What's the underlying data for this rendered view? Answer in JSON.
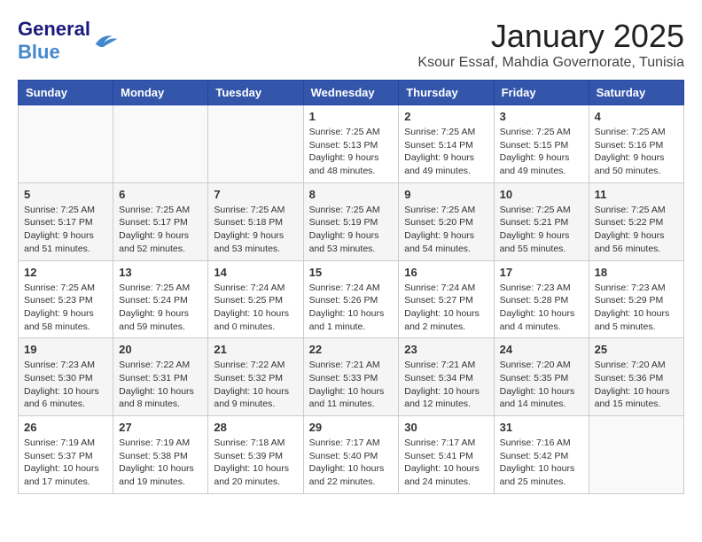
{
  "logo": {
    "general": "General",
    "blue": "Blue"
  },
  "title": "January 2025",
  "subtitle": "Ksour Essaf, Mahdia Governorate, Tunisia",
  "days_of_week": [
    "Sunday",
    "Monday",
    "Tuesday",
    "Wednesday",
    "Thursday",
    "Friday",
    "Saturday"
  ],
  "weeks": [
    [
      {
        "day": "",
        "info": ""
      },
      {
        "day": "",
        "info": ""
      },
      {
        "day": "",
        "info": ""
      },
      {
        "day": "1",
        "info": "Sunrise: 7:25 AM\nSunset: 5:13 PM\nDaylight: 9 hours\nand 48 minutes."
      },
      {
        "day": "2",
        "info": "Sunrise: 7:25 AM\nSunset: 5:14 PM\nDaylight: 9 hours\nand 49 minutes."
      },
      {
        "day": "3",
        "info": "Sunrise: 7:25 AM\nSunset: 5:15 PM\nDaylight: 9 hours\nand 49 minutes."
      },
      {
        "day": "4",
        "info": "Sunrise: 7:25 AM\nSunset: 5:16 PM\nDaylight: 9 hours\nand 50 minutes."
      }
    ],
    [
      {
        "day": "5",
        "info": "Sunrise: 7:25 AM\nSunset: 5:17 PM\nDaylight: 9 hours\nand 51 minutes."
      },
      {
        "day": "6",
        "info": "Sunrise: 7:25 AM\nSunset: 5:17 PM\nDaylight: 9 hours\nand 52 minutes."
      },
      {
        "day": "7",
        "info": "Sunrise: 7:25 AM\nSunset: 5:18 PM\nDaylight: 9 hours\nand 53 minutes."
      },
      {
        "day": "8",
        "info": "Sunrise: 7:25 AM\nSunset: 5:19 PM\nDaylight: 9 hours\nand 53 minutes."
      },
      {
        "day": "9",
        "info": "Sunrise: 7:25 AM\nSunset: 5:20 PM\nDaylight: 9 hours\nand 54 minutes."
      },
      {
        "day": "10",
        "info": "Sunrise: 7:25 AM\nSunset: 5:21 PM\nDaylight: 9 hours\nand 55 minutes."
      },
      {
        "day": "11",
        "info": "Sunrise: 7:25 AM\nSunset: 5:22 PM\nDaylight: 9 hours\nand 56 minutes."
      }
    ],
    [
      {
        "day": "12",
        "info": "Sunrise: 7:25 AM\nSunset: 5:23 PM\nDaylight: 9 hours\nand 58 minutes."
      },
      {
        "day": "13",
        "info": "Sunrise: 7:25 AM\nSunset: 5:24 PM\nDaylight: 9 hours\nand 59 minutes."
      },
      {
        "day": "14",
        "info": "Sunrise: 7:24 AM\nSunset: 5:25 PM\nDaylight: 10 hours\nand 0 minutes."
      },
      {
        "day": "15",
        "info": "Sunrise: 7:24 AM\nSunset: 5:26 PM\nDaylight: 10 hours\nand 1 minute."
      },
      {
        "day": "16",
        "info": "Sunrise: 7:24 AM\nSunset: 5:27 PM\nDaylight: 10 hours\nand 2 minutes."
      },
      {
        "day": "17",
        "info": "Sunrise: 7:23 AM\nSunset: 5:28 PM\nDaylight: 10 hours\nand 4 minutes."
      },
      {
        "day": "18",
        "info": "Sunrise: 7:23 AM\nSunset: 5:29 PM\nDaylight: 10 hours\nand 5 minutes."
      }
    ],
    [
      {
        "day": "19",
        "info": "Sunrise: 7:23 AM\nSunset: 5:30 PM\nDaylight: 10 hours\nand 6 minutes."
      },
      {
        "day": "20",
        "info": "Sunrise: 7:22 AM\nSunset: 5:31 PM\nDaylight: 10 hours\nand 8 minutes."
      },
      {
        "day": "21",
        "info": "Sunrise: 7:22 AM\nSunset: 5:32 PM\nDaylight: 10 hours\nand 9 minutes."
      },
      {
        "day": "22",
        "info": "Sunrise: 7:21 AM\nSunset: 5:33 PM\nDaylight: 10 hours\nand 11 minutes."
      },
      {
        "day": "23",
        "info": "Sunrise: 7:21 AM\nSunset: 5:34 PM\nDaylight: 10 hours\nand 12 minutes."
      },
      {
        "day": "24",
        "info": "Sunrise: 7:20 AM\nSunset: 5:35 PM\nDaylight: 10 hours\nand 14 minutes."
      },
      {
        "day": "25",
        "info": "Sunrise: 7:20 AM\nSunset: 5:36 PM\nDaylight: 10 hours\nand 15 minutes."
      }
    ],
    [
      {
        "day": "26",
        "info": "Sunrise: 7:19 AM\nSunset: 5:37 PM\nDaylight: 10 hours\nand 17 minutes."
      },
      {
        "day": "27",
        "info": "Sunrise: 7:19 AM\nSunset: 5:38 PM\nDaylight: 10 hours\nand 19 minutes."
      },
      {
        "day": "28",
        "info": "Sunrise: 7:18 AM\nSunset: 5:39 PM\nDaylight: 10 hours\nand 20 minutes."
      },
      {
        "day": "29",
        "info": "Sunrise: 7:17 AM\nSunset: 5:40 PM\nDaylight: 10 hours\nand 22 minutes."
      },
      {
        "day": "30",
        "info": "Sunrise: 7:17 AM\nSunset: 5:41 PM\nDaylight: 10 hours\nand 24 minutes."
      },
      {
        "day": "31",
        "info": "Sunrise: 7:16 AM\nSunset: 5:42 PM\nDaylight: 10 hours\nand 25 minutes."
      },
      {
        "day": "",
        "info": ""
      }
    ]
  ]
}
